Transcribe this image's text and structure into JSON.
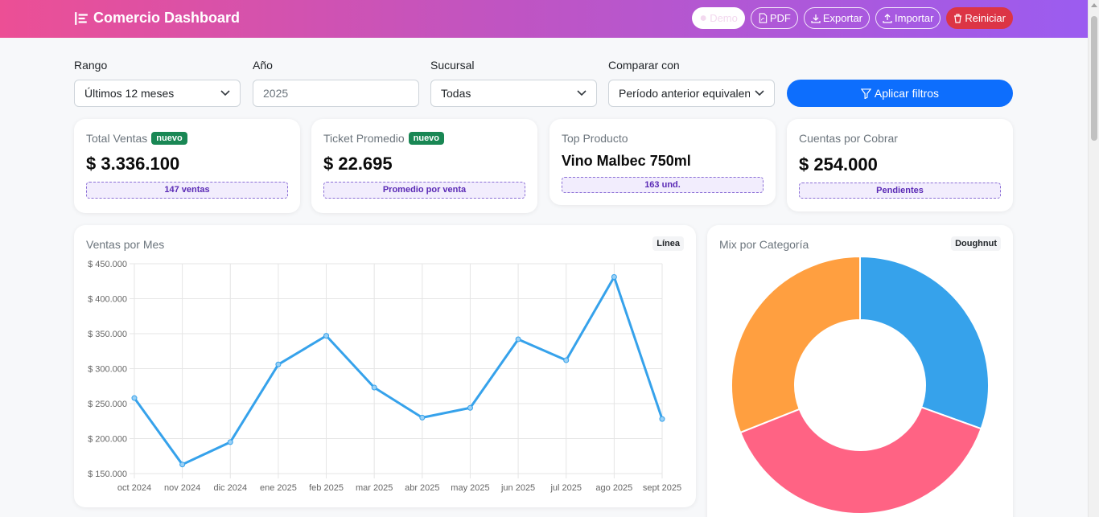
{
  "header": {
    "title": "Comercio Dashboard",
    "buttons": {
      "demo": "Demo",
      "pdf": "PDF",
      "export": "Exportar",
      "import": "Importar",
      "reset": "Reiniciar"
    }
  },
  "filters": {
    "range": {
      "label": "Rango",
      "value": "Últimos 12 meses"
    },
    "year": {
      "label": "Año",
      "value": "2025"
    },
    "branch": {
      "label": "Sucursal",
      "value": "Todas"
    },
    "compare": {
      "label": "Comparar con",
      "value": "Período anterior equivalente"
    },
    "apply_label": "Aplicar filtros"
  },
  "kpis": {
    "total_sales": {
      "title": "Total Ventas",
      "badge": "nuevo",
      "value": "$ 3.336.100",
      "note": "147 ventas"
    },
    "avg_ticket": {
      "title": "Ticket Promedio",
      "badge": "nuevo",
      "value": "$ 22.695",
      "note": "Promedio por venta"
    },
    "top_product": {
      "title": "Top Producto",
      "value": "Vino Malbec 750ml",
      "note": "163 und."
    },
    "receivables": {
      "title": "Cuentas por Cobrar",
      "value": "$ 254.000",
      "note": "Pendientes"
    }
  },
  "colors": {
    "primary": "#0d6efd",
    "line": "#36a2eb",
    "badge": "#198754",
    "reset": "#dc3545",
    "doughnut": [
      "#36a2eb",
      "#ff6384",
      "#ff9f40"
    ]
  },
  "chart_data": [
    {
      "type": "line",
      "title": "Ventas por Mes",
      "chip": "Línea",
      "categories": [
        "oct 2024",
        "nov 2024",
        "dic 2024",
        "ene 2025",
        "feb 2025",
        "mar 2025",
        "abr 2025",
        "may 2025",
        "jun 2025",
        "jul 2025",
        "ago 2025",
        "sept 2025"
      ],
      "values": [
        258000,
        163000,
        195000,
        306000,
        347000,
        273000,
        230000,
        244000,
        342000,
        312000,
        431000,
        228000
      ],
      "ylim": [
        150000,
        450000
      ],
      "yticks": [
        "$ 450.000",
        "$ 400.000",
        "$ 350.000",
        "$ 300.000",
        "$ 250.000",
        "$ 200.000",
        "$ 150.000"
      ],
      "grid": true
    },
    {
      "type": "pie",
      "title": "Mix por Categoría",
      "chip": "Doughnut",
      "values": [
        30.5,
        38.5,
        31.0
      ]
    }
  ]
}
